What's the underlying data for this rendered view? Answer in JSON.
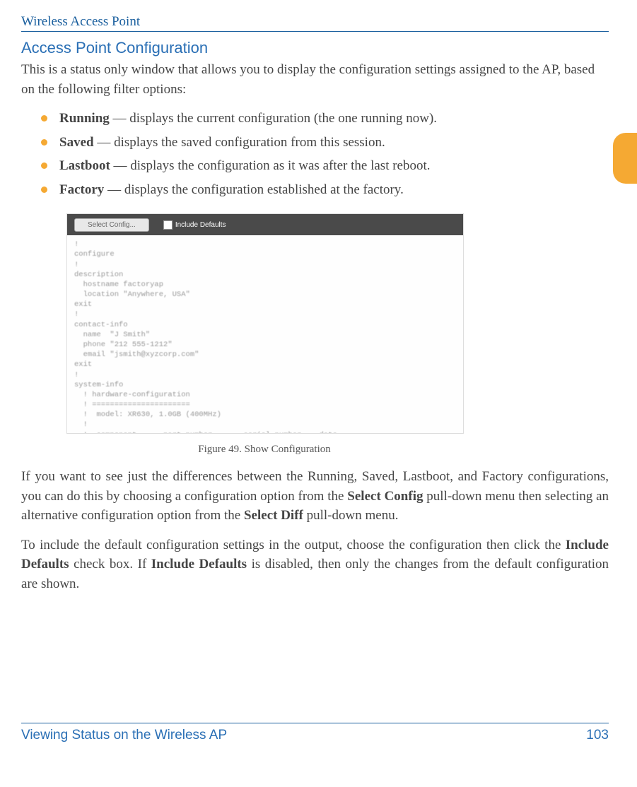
{
  "header": {
    "title": "Wireless Access Point"
  },
  "section": {
    "title": "Access Point Configuration",
    "intro": "This is a status only window that allows you to display the configuration settings assigned to the AP, based on the following filter options:"
  },
  "bullets": [
    {
      "term": "Running",
      "desc": " — displays the current configuration (the one running now)."
    },
    {
      "term": "Saved",
      "desc": " — displays the saved configuration from this session."
    },
    {
      "term": "Lastboot",
      "desc": " — displays the configuration as it was after the last reboot."
    },
    {
      "term": "Factory",
      "desc": " — displays the configuration established at the factory."
    }
  ],
  "figure": {
    "button_label": "Select Config...",
    "checkbox_label": "Include Defaults",
    "code": "!\nconfigure\n!\ndescription\n  hostname factoryap\n  location \"Anywhere, USA\"\nexit\n!\ncontact-info\n  name  \"J Smith\"\n  phone \"212 555-1212\"\n  email \"jsmith@xyzcorp.com\"\nexit\n!\nsystem-info\n  ! hardware-configuration\n  ! ======================\n  !  model: XR630, 1.0GB (400MHz)\n  !\n  !  component      part number       serial number    date",
    "caption": "Figure 49. Show Configuration"
  },
  "para1_parts": {
    "a": "If you want to see just the differences between the Running, Saved, Lastboot, and Factory configurations, you can do this by choosing a configuration option from the ",
    "b": "Select Config",
    "c": " pull-down menu then selecting an alternative configuration option from the ",
    "d": "Select Diff",
    "e": " pull-down menu."
  },
  "para2_parts": {
    "a": "To include the default configuration settings in the output, choose the configuration then click the ",
    "b": "Include Defaults",
    "c": " check box. If ",
    "d": "Include Defaults",
    "e": " is disabled, then only the changes from the default configuration are shown."
  },
  "footer": {
    "left": "Viewing Status on the Wireless AP",
    "page": "103"
  }
}
